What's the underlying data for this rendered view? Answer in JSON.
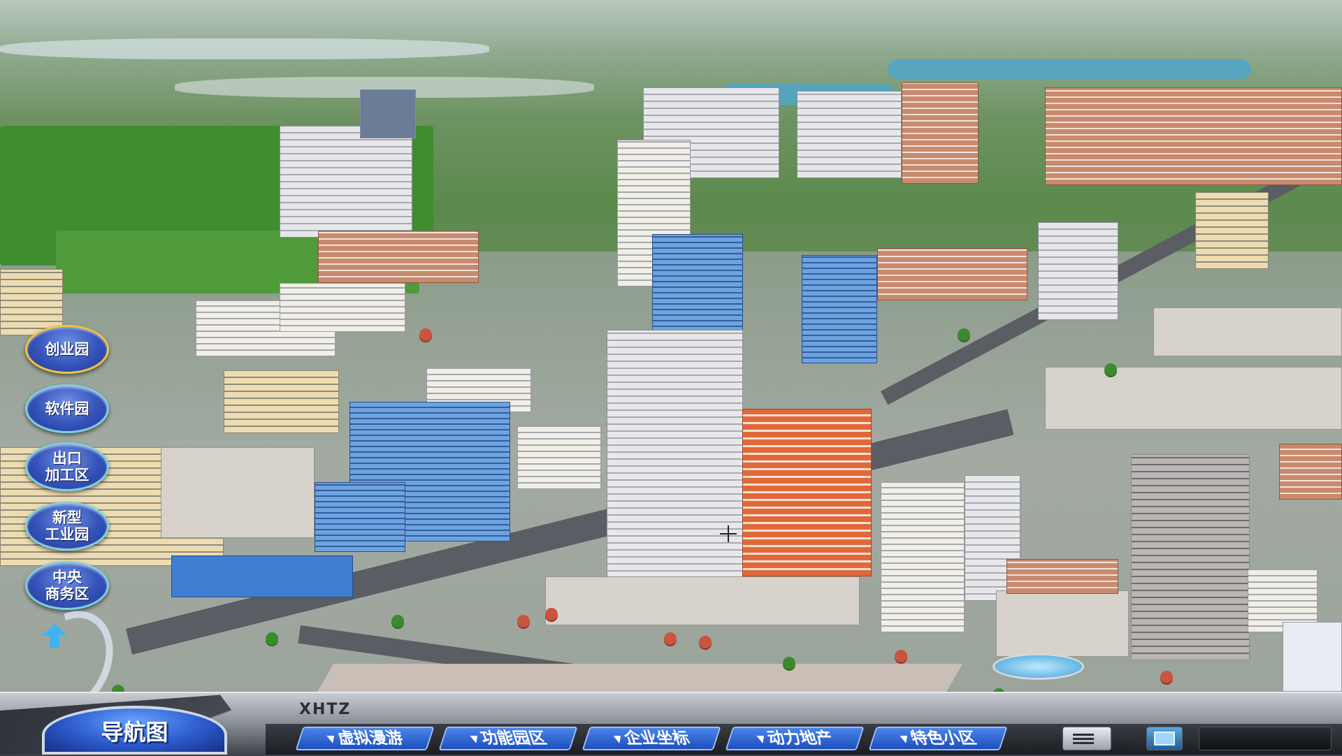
{
  "side_nav": {
    "items": [
      {
        "label": "创业园",
        "active": true
      },
      {
        "label": "软件园",
        "active": false
      },
      {
        "label": "出口\n加工区",
        "active": false
      },
      {
        "label": "新型\n工业园",
        "active": false
      },
      {
        "label": "中央\n商务区",
        "active": false
      }
    ],
    "up_icon": "up-arrow-icon"
  },
  "bottom_bar": {
    "brand": "XHTZ",
    "main_button": "导航图",
    "tabs": [
      {
        "label": "虚拟漫游",
        "caret": "▼"
      },
      {
        "label": "功能园区",
        "caret": "▼"
      },
      {
        "label": "企业坐标",
        "caret": "▼"
      },
      {
        "label": "动力地产",
        "caret": "▼"
      },
      {
        "label": "特色小区",
        "caret": "▼"
      }
    ],
    "tools": [
      "list-icon",
      "screen-icon",
      "panel-icon"
    ]
  },
  "colors": {
    "accent_blue": "#2f5fd1",
    "side_button_border": "#7fcfe0",
    "active_border": "#f2c33a"
  }
}
